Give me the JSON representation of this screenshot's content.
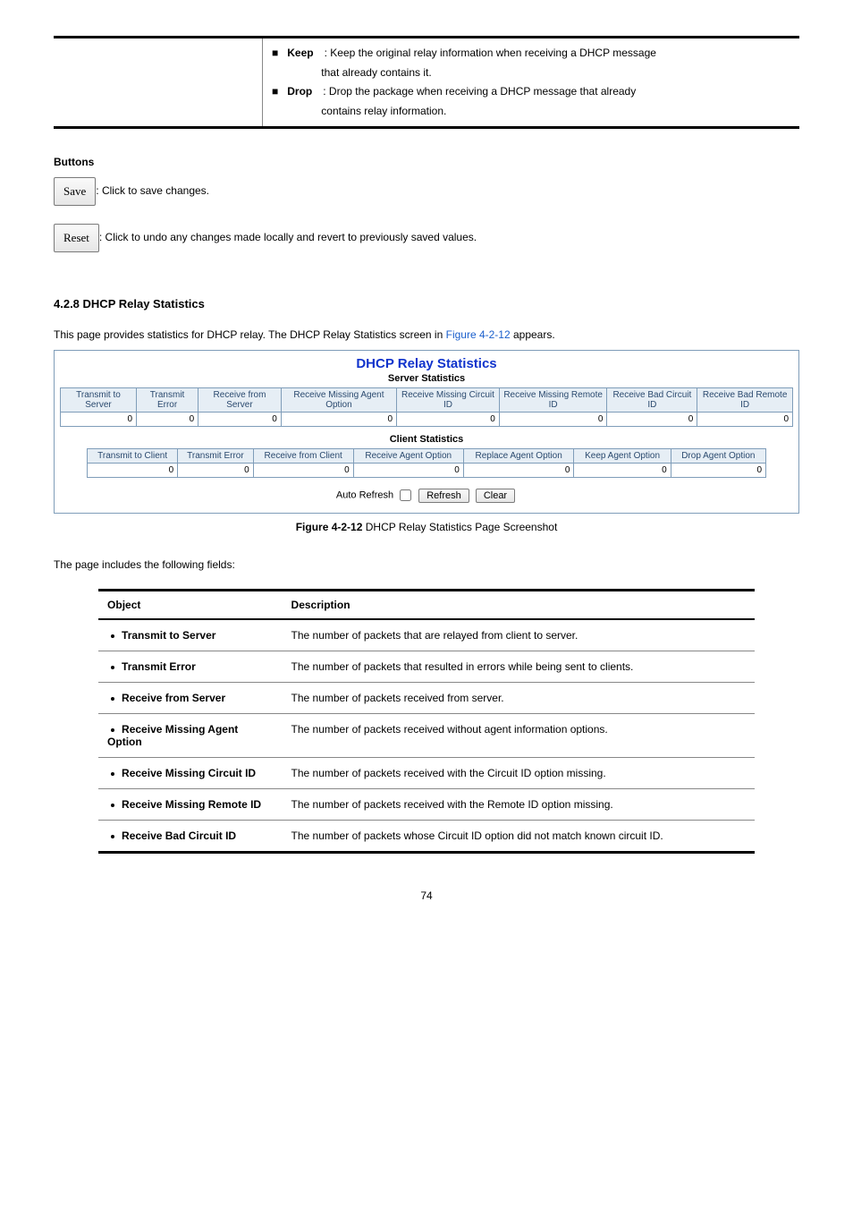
{
  "prev_section": {
    "keep_label": "Keep",
    "keep_desc1": ": Keep the original relay information when receiving a DHCP message",
    "keep_desc2": "that already contains it.",
    "drop_label": "Drop",
    "drop_desc1": ": Drop the package when receiving a DHCP message that already",
    "drop_desc2": "contains relay information."
  },
  "buttons_desc": {
    "save_label": "Save",
    "save_text": ": Click to save changes.",
    "reset_label": "Reset",
    "reset_text": ": Click to undo any changes made locally and revert to previously saved values."
  },
  "heading": "4.2.8 DHCP Relay Statistics",
  "intro": {
    "prefix": "This page provides statistics for DHCP relay. The DHCP Relay Statistics screen in ",
    "figure_link": "Figure 4-2-12",
    "suffix": " appears."
  },
  "stats": {
    "title": "DHCP Relay Statistics",
    "server_sub": "Server Statistics",
    "server_headers": [
      "Transmit to Server",
      "Transmit Error",
      "Receive from Server",
      "Receive Missing Agent Option",
      "Receive Missing Circuit ID",
      "Receive Missing Remote ID",
      "Receive Bad Circuit ID",
      "Receive Bad Remote ID"
    ],
    "server_values": [
      "0",
      "0",
      "0",
      "0",
      "0",
      "0",
      "0",
      "0"
    ],
    "client_sub": "Client Statistics",
    "client_headers": [
      "Transmit to Client",
      "Transmit Error",
      "Receive from Client",
      "Receive Agent Option",
      "Replace Agent Option",
      "Keep Agent Option",
      "Drop Agent Option"
    ],
    "client_values": [
      "0",
      "0",
      "0",
      "0",
      "0",
      "0",
      "0"
    ],
    "auto_refresh_label": "Auto Refresh",
    "refresh_btn": "Refresh",
    "clear_btn": "Clear"
  },
  "figure_caption_prefix": "Figure 4-2-12",
  "figure_caption_suffix": " DHCP Relay Statistics Page Screenshot",
  "fields_intro": "The page includes the following fields:",
  "fields_table": {
    "h1": "Object",
    "h2": "Description",
    "rows": [
      {
        "obj": "Transmit to Server",
        "desc": "The number of packets that are relayed from client to server."
      },
      {
        "obj": "Transmit Error",
        "desc": "The number of packets that resulted in errors while being sent to clients."
      },
      {
        "obj": "Receive from Server",
        "desc": "The number of packets received from server."
      },
      {
        "obj": "Receive Missing Agent Option",
        "desc": "The number of packets received without agent information options."
      },
      {
        "obj": "Receive Missing Circuit ID",
        "desc": "The number of packets received with the Circuit ID option missing."
      },
      {
        "obj": "Receive Missing Remote ID",
        "desc": "The number of packets received with the Remote ID option missing."
      },
      {
        "obj": "Receive Bad Circuit ID",
        "desc": "The number of packets whose Circuit ID option did not match known circuit ID."
      }
    ]
  },
  "page_number": "74"
}
